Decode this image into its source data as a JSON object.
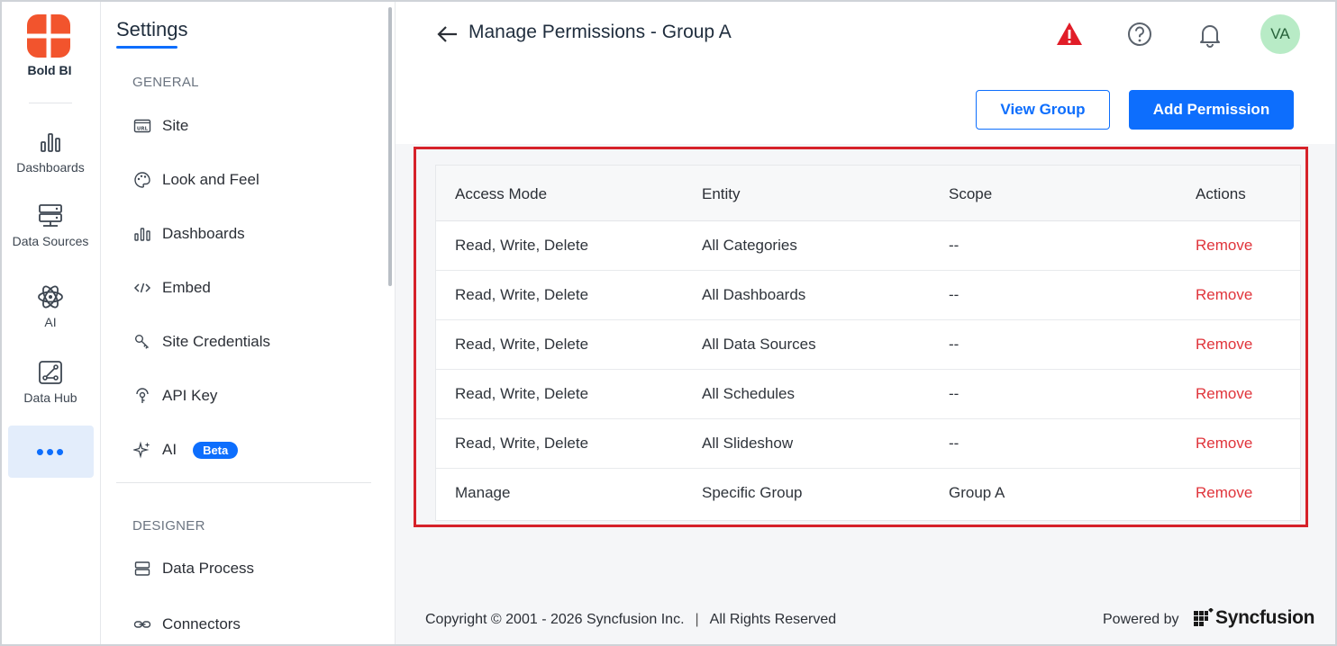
{
  "rail": {
    "logo_text": "Bold BI",
    "items": [
      {
        "label": "Dashboards",
        "icon": "bar-chart-icon"
      },
      {
        "label": "Data Sources",
        "icon": "server-icon"
      },
      {
        "label": "AI",
        "icon": "atom-icon"
      },
      {
        "label": "Data Hub",
        "icon": "data-hub-icon"
      }
    ],
    "more_label": "•••"
  },
  "settings": {
    "title": "Settings",
    "general_heading": "GENERAL",
    "general_items": [
      {
        "label": "Site",
        "icon": "url-icon"
      },
      {
        "label": "Look and Feel",
        "icon": "palette-icon"
      },
      {
        "label": "Dashboards",
        "icon": "bar-chart-icon"
      },
      {
        "label": "Embed",
        "icon": "code-icon"
      },
      {
        "label": "Site Credentials",
        "icon": "key-icon"
      },
      {
        "label": "API Key",
        "icon": "api-key-icon"
      },
      {
        "label": "AI",
        "icon": "sparkle-icon",
        "badge": "Beta"
      }
    ],
    "designer_heading": "DESIGNER",
    "designer_items": [
      {
        "label": "Data Process",
        "icon": "data-process-icon"
      },
      {
        "label": "Connectors",
        "icon": "link-icon"
      }
    ]
  },
  "header": {
    "title": "Manage Permissions - Group A",
    "avatar_initials": "VA",
    "view_group_label": "View Group",
    "add_permission_label": "Add Permission"
  },
  "table": {
    "columns": [
      "Access Mode",
      "Entity",
      "Scope",
      "Actions"
    ],
    "rows": [
      {
        "access": "Read, Write, Delete",
        "entity": "All Categories",
        "scope": "--",
        "action": "Remove"
      },
      {
        "access": "Read, Write, Delete",
        "entity": "All Dashboards",
        "scope": "--",
        "action": "Remove"
      },
      {
        "access": "Read, Write, Delete",
        "entity": "All Data Sources",
        "scope": "--",
        "action": "Remove"
      },
      {
        "access": "Read, Write, Delete",
        "entity": "All Schedules",
        "scope": "--",
        "action": "Remove"
      },
      {
        "access": "Read, Write, Delete",
        "entity": "All Slideshow",
        "scope": "--",
        "action": "Remove"
      },
      {
        "access": "Manage",
        "entity": "Specific Group",
        "scope": "Group A",
        "action": "Remove"
      }
    ]
  },
  "footer": {
    "copyright": "Copyright © 2001 - 2026 Syncfusion Inc.",
    "separator": "|",
    "rights": "All Rights Reserved",
    "powered_by": "Powered by",
    "brand": "Syncfusion"
  },
  "colors": {
    "accent": "#0d6efd",
    "remove": "#e0343b",
    "highlight_border": "#d6222a",
    "avatar_bg": "#b8ebc6",
    "warning": "#e11d28"
  }
}
